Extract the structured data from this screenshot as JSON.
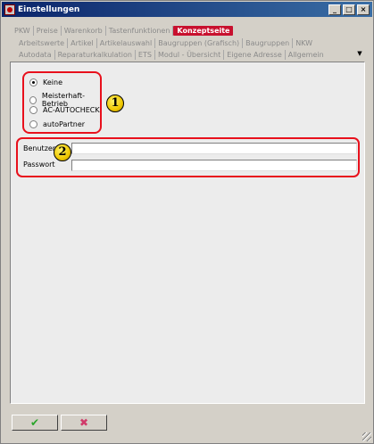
{
  "window": {
    "title": "Einstellungen",
    "minimize_glyph": "_",
    "maximize_glyph": "□",
    "close_glyph": "×"
  },
  "tabs": {
    "row1": [
      "PKW",
      "Preise",
      "Warenkorb",
      "Tastenfunktionen",
      "Konzeptseite"
    ],
    "row1_active_index": 4,
    "row2": [
      "Arbeitswerte",
      "Artikel",
      "Artikelauswahl",
      "Baugruppen (Grafisch)",
      "Baugruppen",
      "NKW"
    ],
    "row3": [
      "Autodata",
      "Reparaturkalkulation",
      "ETS",
      "Modul - Übersicht",
      "Eigene Adresse",
      "Allgemein"
    ],
    "scroll_glyph": "▼"
  },
  "concept": {
    "options": [
      "Keine",
      "Meisterhaft-Betrieb",
      "AC-AUTOCHECK",
      "autoPartner"
    ],
    "selected_index": 0,
    "badge_label": "1"
  },
  "login": {
    "user_label": "Benutzer",
    "user_value": "",
    "password_label": "Passwort",
    "password_value": "",
    "badge_label": "2"
  },
  "buttons": {
    "ok_glyph": "✔",
    "cancel_glyph": "✖"
  },
  "colors": {
    "active_tab": "#c8102e",
    "highlight": "#e8101c",
    "badge": "#f0c800",
    "ok": "#2aa52a",
    "cancel": "#d03a6a"
  }
}
